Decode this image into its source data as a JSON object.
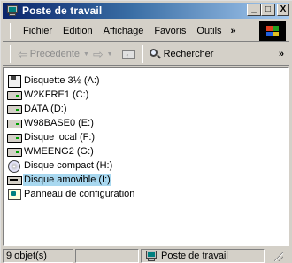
{
  "window": {
    "title": "Poste de travail"
  },
  "title_buttons": {
    "minimize": "_",
    "maximize": "□",
    "close": "X"
  },
  "menu": {
    "items": [
      "Fichier",
      "Edition",
      "Affichage",
      "Favoris",
      "Outils"
    ],
    "overflow": "»"
  },
  "toolbar": {
    "back_label": "Précédente",
    "search_label": "Rechercher",
    "overflow": "»"
  },
  "drives": [
    {
      "label": "Disquette 3½ (A:)",
      "icon": "floppy-icon",
      "selected": false
    },
    {
      "label": "W2KFRE1 (C:)",
      "icon": "hard-drive-icon",
      "selected": false
    },
    {
      "label": "DATA (D:)",
      "icon": "hard-drive-icon",
      "selected": false
    },
    {
      "label": "W98BASE0 (E:)",
      "icon": "hard-drive-icon",
      "selected": false
    },
    {
      "label": "Disque local (F:)",
      "icon": "hard-drive-icon",
      "selected": false
    },
    {
      "label": "WMEENG2 (G:)",
      "icon": "hard-drive-icon",
      "selected": false
    },
    {
      "label": "Disque compact (H:)",
      "icon": "cd-drive-icon",
      "selected": false
    },
    {
      "label": "Disque amovible (I:)",
      "icon": "removable-drive-icon",
      "selected": true
    },
    {
      "label": "Panneau de configuration",
      "icon": "control-panel-icon",
      "selected": false
    }
  ],
  "status": {
    "count": "9 objet(s)",
    "location": "Poste de travail"
  },
  "colors": {
    "titlebar_start": "#0a246a",
    "titlebar_end": "#a6caf0",
    "selection": "#a8d8f0",
    "chrome": "#d4d0c8"
  }
}
